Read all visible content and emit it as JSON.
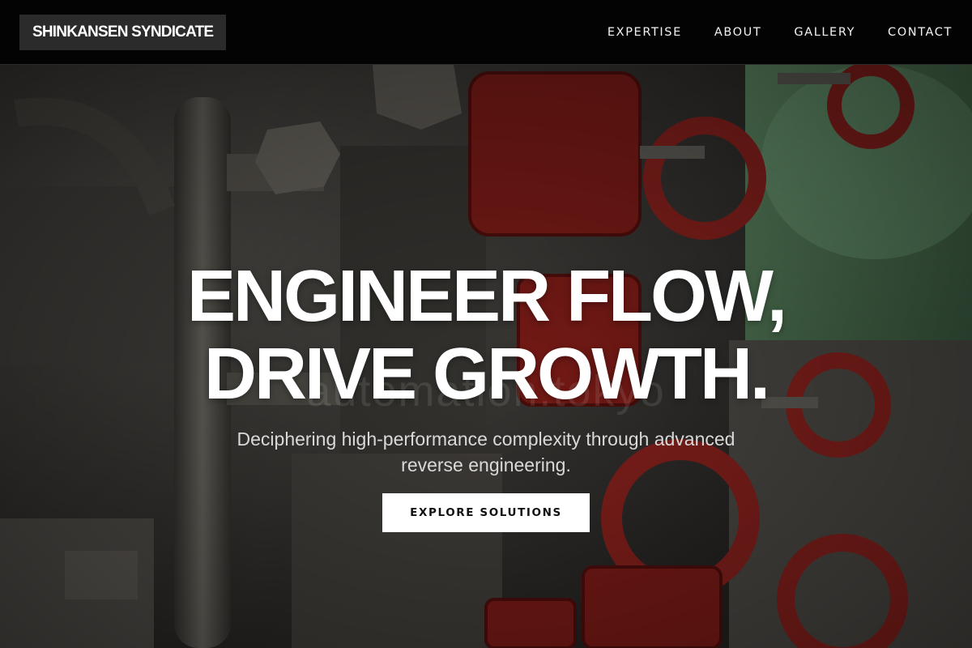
{
  "header": {
    "brand": "SHINKANSEN SYNDICATE",
    "nav": [
      {
        "label": "EXPERTISE"
      },
      {
        "label": "ABOUT"
      },
      {
        "label": "GALLERY"
      },
      {
        "label": "CONTACT"
      }
    ]
  },
  "hero": {
    "headline_line1": "ENGINEER FLOW,",
    "headline_line2": "DRIVE GROWTH.",
    "watermark": "automation.tokyo",
    "subtitle": "Deciphering high-performance complexity through advanced reverse engineering.",
    "cta_label": "EXPLORE SOLUTIONS",
    "background_image": "industrial-red-valves-photo"
  },
  "colors": {
    "header_bg": "#030303",
    "brand_bg": "#2b2b2b",
    "text_primary": "#ffffff",
    "valve_red": "#8e1f1a",
    "pipe_grey": "#5e5b55",
    "accent_green": "#6fae78",
    "cta_bg": "#ffffff"
  }
}
